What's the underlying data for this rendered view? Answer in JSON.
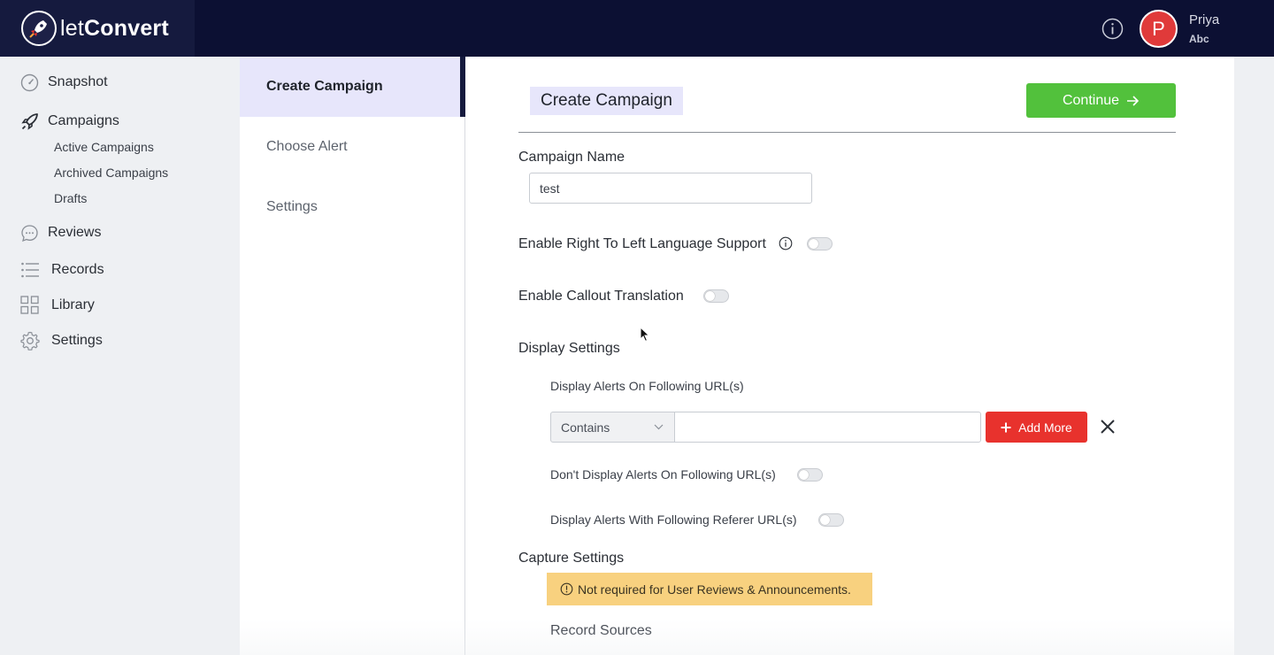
{
  "brand": {
    "name_light": "let",
    "name_bold": "Convert"
  },
  "user": {
    "initial": "P",
    "name": "Priya",
    "org": "Abc"
  },
  "sidebar": {
    "items": [
      {
        "label": "Snapshot",
        "icon": "gauge-icon"
      },
      {
        "label": "Campaigns",
        "icon": "rocket-icon"
      },
      {
        "label": "Reviews",
        "icon": "chat-icon"
      },
      {
        "label": "Records",
        "icon": "list-icon"
      },
      {
        "label": "Library",
        "icon": "grid-icon"
      },
      {
        "label": "Settings",
        "icon": "gear-icon"
      }
    ],
    "campaign_sub": [
      "Active Campaigns",
      "Archived Campaigns",
      "Drafts"
    ]
  },
  "steps": [
    "Create Campaign",
    "Choose Alert",
    "Settings"
  ],
  "main": {
    "title": "Create Campaign",
    "continue_label": "Continue",
    "campaign_name_label": "Campaign Name",
    "campaign_name_value": "test",
    "rtl_label": "Enable Right To Left Language Support",
    "callout_label": "Enable Callout Translation",
    "display_settings_label": "Display Settings",
    "display_urls_label": "Display Alerts On Following URL(s)",
    "match_option": "Contains",
    "add_more_label": "Add More",
    "dont_display_label": "Don't Display Alerts On Following URL(s)",
    "referer_label": "Display Alerts With Following Referer URL(s)",
    "capture_settings_label": "Capture Settings",
    "notice_text": "Not required for User Reviews & Announcements.",
    "record_sources_label": "Record Sources"
  },
  "colors": {
    "topbar": "#0c1033",
    "accent_green": "#52c13c",
    "accent_red": "#e8322d",
    "notice_bg": "#f8d17f",
    "active_step_bg": "#e7e6fb"
  }
}
